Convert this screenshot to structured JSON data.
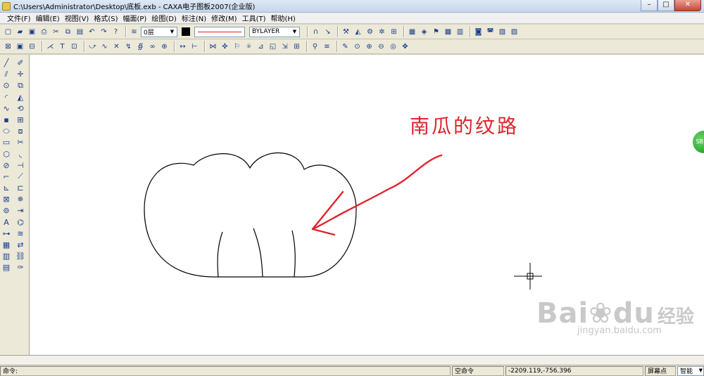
{
  "window": {
    "title": "C:\\Users\\Administrator\\Desktop\\底板.exb - CAXA电子图板2007(企业版)",
    "min": "–",
    "max": "□",
    "close": "✕"
  },
  "menu": [
    "文件(F)",
    "编辑(E)",
    "视图(V)",
    "格式(S)",
    "幅面(P)",
    "绘图(D)",
    "标注(N)",
    "修改(M)",
    "工具(T)",
    "帮助(H)"
  ],
  "toolbar": {
    "layer": "0层",
    "linetype_color": "#e02020",
    "bylayer": "BYLAYER",
    "color": "#000000"
  },
  "annotation": {
    "text": "南瓜的纹路",
    "color": "#e0242d"
  },
  "side_badge": "SB",
  "watermark": {
    "brand": "Bai",
    "brand2": "du",
    "cn": "经验",
    "url": "jingyan.baidu.com"
  },
  "status": {
    "command_label": "命令:",
    "command_state": "空命令",
    "coords": "-2209.119,-756.396",
    "snap_label": "屏幕点",
    "snap_mode": "智能"
  },
  "icons": {
    "toolbar1": [
      "new-icon",
      "open-icon",
      "save-icon",
      "print-icon",
      "cut-icon",
      "copy-icon",
      "paste-icon",
      "undo-icon",
      "redo-icon",
      "help-icon",
      "layer-icon"
    ],
    "colors": {
      "canvas": "#ffffff",
      "ui": "#ece9d8"
    }
  }
}
